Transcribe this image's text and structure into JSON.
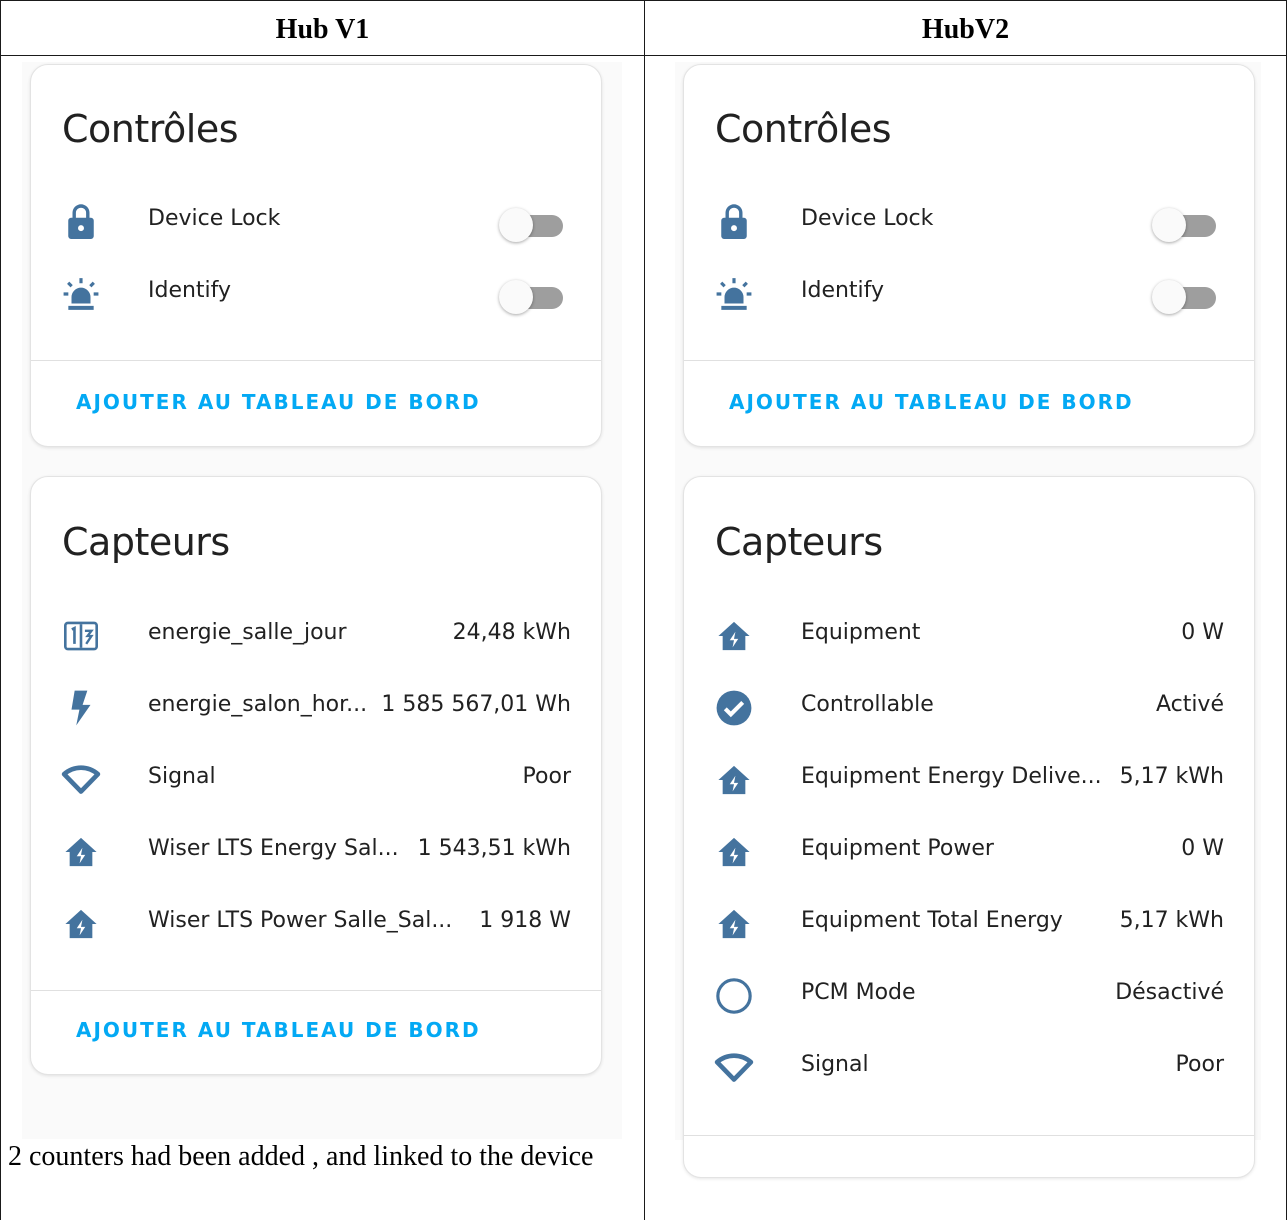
{
  "columns": [
    {
      "heading": "Hub V1",
      "controls": {
        "title": "Contrôles",
        "items": [
          {
            "icon": "lock-icon",
            "label": "Device Lock",
            "toggle_on": false
          },
          {
            "icon": "alarm-light-icon",
            "label": "Identify",
            "toggle_on": false
          }
        ],
        "action": "AJOUTER AU TABLEAU DE BORD"
      },
      "sensors": {
        "title": "Capteurs",
        "items": [
          {
            "icon": "counter-icon",
            "label": "energie_salle_jour",
            "value": "24,48 kWh"
          },
          {
            "icon": "flash-icon",
            "label": "energie_salon_hor...",
            "value": "1 585 567,01 Wh"
          },
          {
            "icon": "wifi-signal-icon",
            "label": "Signal",
            "value": "Poor"
          },
          {
            "icon": "home-lightning-icon",
            "label": "Wiser LTS Energy Sal...",
            "value": "1 543,51 kWh"
          },
          {
            "icon": "home-lightning-icon",
            "label": "Wiser LTS Power Salle_Sal...",
            "value": "1 918 W"
          }
        ],
        "action": "AJOUTER AU TABLEAU DE BORD"
      },
      "note": "2 counters had been added , and linked to the device"
    },
    {
      "heading": "HubV2",
      "controls": {
        "title": "Contrôles",
        "items": [
          {
            "icon": "lock-icon",
            "label": "Device Lock",
            "toggle_on": false
          },
          {
            "icon": "alarm-light-icon",
            "label": "Identify",
            "toggle_on": false
          }
        ],
        "action": "AJOUTER AU TABLEAU DE BORD"
      },
      "sensors": {
        "title": "Capteurs",
        "items": [
          {
            "icon": "home-lightning-icon",
            "label": "Equipment",
            "value": "0 W"
          },
          {
            "icon": "check-circle-icon",
            "label": "Controllable",
            "value": "Activé"
          },
          {
            "icon": "home-lightning-icon",
            "label": "Equipment Energy Delive...",
            "value": "5,17 kWh"
          },
          {
            "icon": "home-lightning-icon",
            "label": "Equipment Power",
            "value": "0 W"
          },
          {
            "icon": "home-lightning-icon",
            "label": "Equipment Total Energy",
            "value": "5,17 kWh"
          },
          {
            "icon": "circle-outline-icon",
            "label": "PCM Mode",
            "value": "Désactivé"
          },
          {
            "icon": "wifi-signal-icon",
            "label": "Signal",
            "value": "Poor"
          }
        ]
      }
    }
  ],
  "colors": {
    "icon": "#44739e",
    "accent": "#03a9f4",
    "text": "#212121",
    "toggle_track": "#9e9e9e",
    "card_border": "#e3e3e3"
  }
}
